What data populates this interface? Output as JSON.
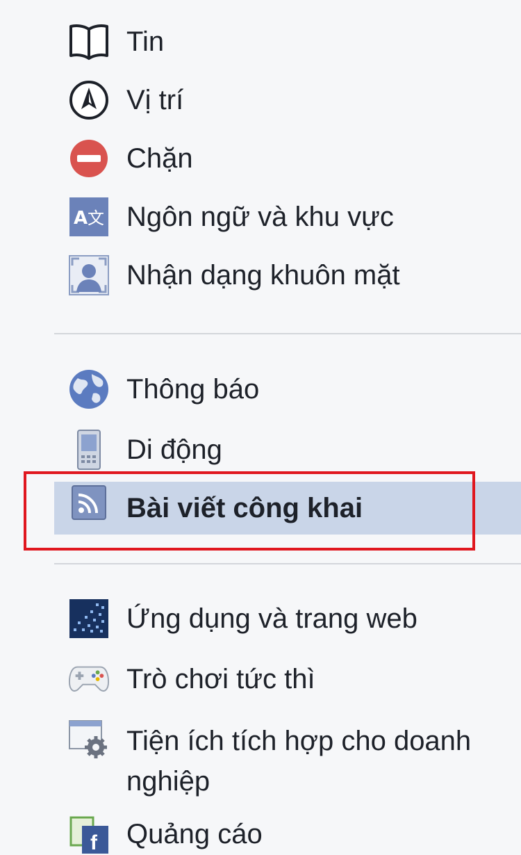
{
  "menu": {
    "group1": [
      {
        "label": "Tin",
        "icon": "book-icon"
      },
      {
        "label": "Vị trí",
        "icon": "location-arrow-icon"
      },
      {
        "label": "Chặn",
        "icon": "block-icon"
      },
      {
        "label": "Ngôn ngữ và khu vực",
        "icon": "language-icon"
      },
      {
        "label": "Nhận dạng khuôn mặt",
        "icon": "face-recognition-icon"
      }
    ],
    "group2": [
      {
        "label": "Thông báo",
        "icon": "globe-icon"
      },
      {
        "label": "Di động",
        "icon": "mobile-icon"
      },
      {
        "label": "Bài viết công khai",
        "icon": "rss-icon",
        "selected": true
      }
    ],
    "group3": [
      {
        "label": "Ứng dụng và trang web",
        "icon": "apps-icon"
      },
      {
        "label": "Trò chơi tức thì",
        "icon": "gamepad-icon"
      },
      {
        "label": "Tiện ích tích hợp cho doanh nghiệp",
        "icon": "business-integrations-icon"
      },
      {
        "label": "Quảng cáo",
        "icon": "ads-icon"
      }
    ]
  },
  "colors": {
    "selected_bg": "#c9d5e8",
    "highlight_border": "#e0171f",
    "facebook_blue": "#4267b2"
  }
}
